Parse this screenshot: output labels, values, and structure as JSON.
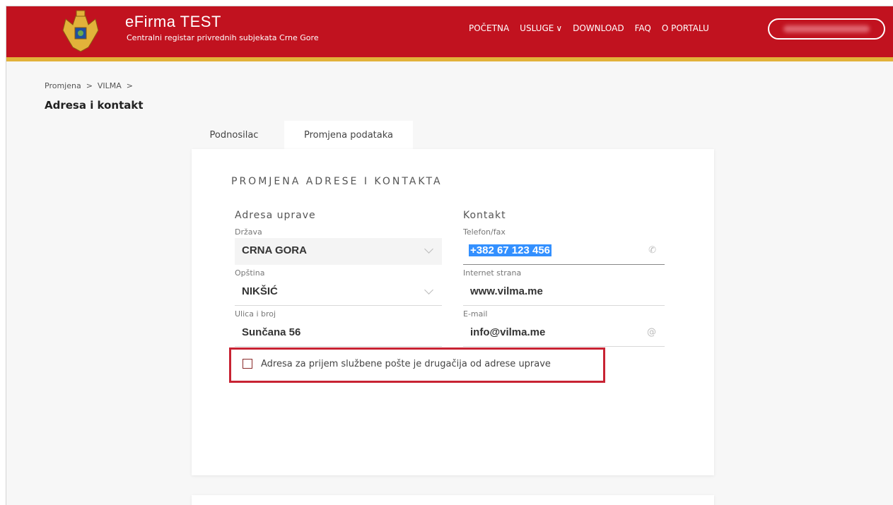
{
  "header": {
    "title": "eFirma TEST",
    "subtitle": "Centralni registar privrednih subjekata Crne Gore",
    "nav": [
      {
        "label": "POČETNA"
      },
      {
        "label": "USLUGE"
      },
      {
        "label": "DOWNLOAD"
      },
      {
        "label": "FAQ"
      },
      {
        "label": "O PORTALU"
      }
    ],
    "colors": {
      "bar": "#c1121f",
      "stripe": "#e2b23a"
    }
  },
  "breadcrumb": "Promjena  >  VILMA  >",
  "page_title": "Adresa i kontakt",
  "tabs": [
    {
      "label": "Podnosilac",
      "active": false
    },
    {
      "label": "Promjena podataka",
      "active": true
    }
  ],
  "form": {
    "section_title": "PROMJENA ADRESE I KONTAKTA",
    "address": {
      "heading": "Adresa uprave",
      "country_label": "Država",
      "country_value": "CRNA GORA",
      "municipality_label": "Opština",
      "municipality_value": "NIKŠIĆ",
      "street_label": "Ulica i broj",
      "street_value": "Sunčana 56"
    },
    "contact": {
      "heading": "Kontakt",
      "phone_label": "Telefon/fax",
      "phone_value": "+382 67 123 456",
      "website_label": "Internet strana",
      "website_value": "www.vilma.me",
      "email_label": "E-mail",
      "email_value": "info@vilma.me"
    },
    "checkbox_label": "Adresa za prijem službene pošte je drugačija od adrese uprave",
    "checkbox_checked": false,
    "icons": {
      "dropdown": "chevron-down-icon",
      "phone": "phone-icon",
      "email": "at-icon"
    }
  }
}
